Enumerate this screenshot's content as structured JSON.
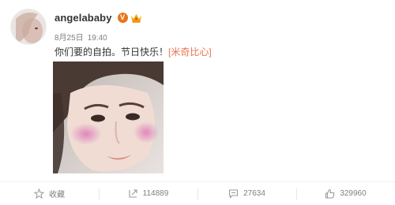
{
  "post": {
    "username": "angelababy",
    "verified_badge": "V",
    "date": "8月25日",
    "time": "19:40",
    "text": "你们要的自拍。节日快乐！",
    "emoticon": "[米奇比心]"
  },
  "actions": {
    "favorite_label": "收藏",
    "repost_count": "114889",
    "comment_count": "27634",
    "like_count": "329960"
  },
  "colors": {
    "verified": "#e8741b",
    "crown": "#f4a300",
    "emoticon": "#eb7350",
    "meta": "#808080"
  },
  "icons": [
    "crown-icon",
    "star-icon",
    "repost-icon",
    "comment-icon",
    "thumbs-up-icon"
  ]
}
